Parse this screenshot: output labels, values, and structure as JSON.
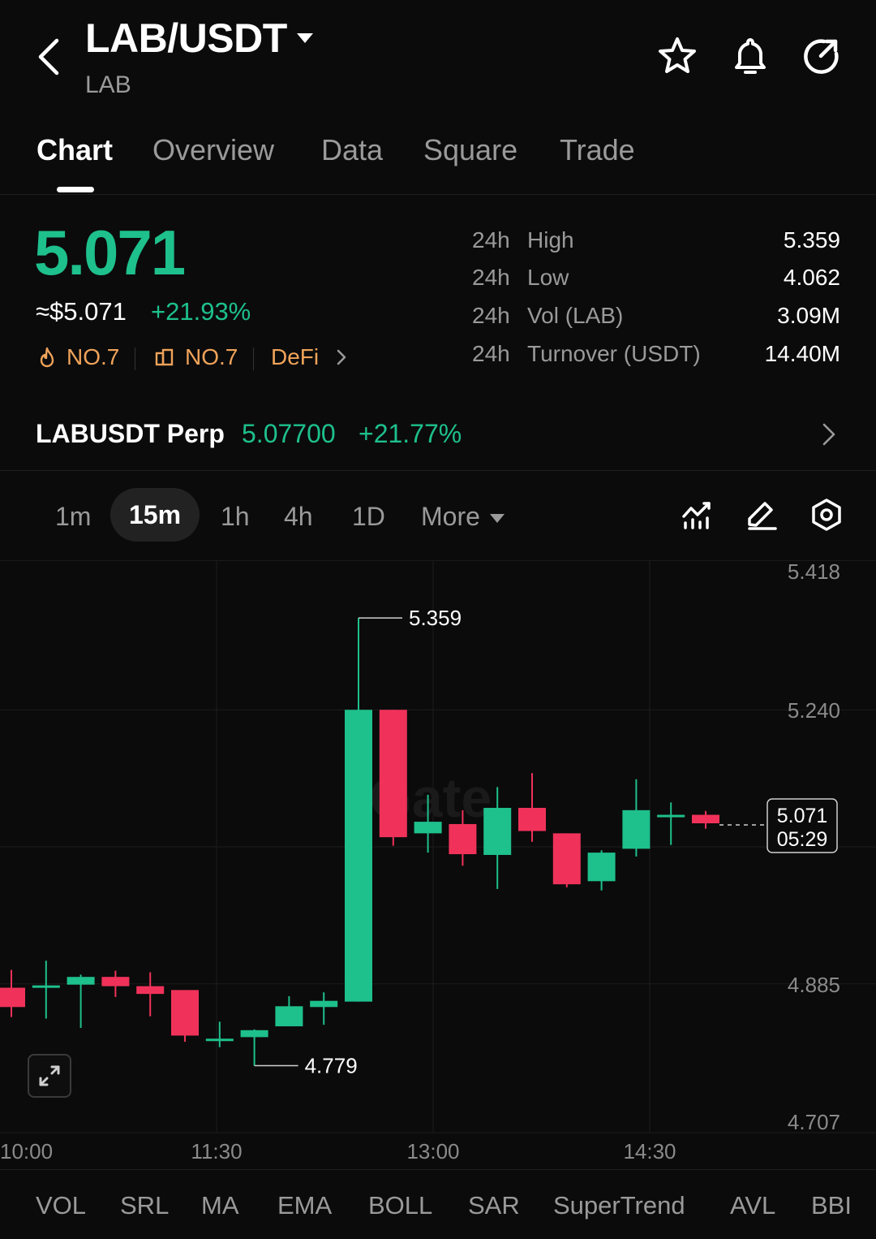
{
  "header": {
    "pair": "LAB/USDT",
    "subtitle": "LAB",
    "icons": [
      "back-arrow-icon",
      "star-icon",
      "bell-icon",
      "share-icon"
    ]
  },
  "tabs": [
    {
      "label": "Chart",
      "active": true
    },
    {
      "label": "Overview",
      "active": false
    },
    {
      "label": "Data",
      "active": false
    },
    {
      "label": "Square",
      "active": false
    },
    {
      "label": "Trade",
      "active": false
    }
  ],
  "price": {
    "last": "5.071",
    "usd": "≈$5.071",
    "change": "+21.93%",
    "tags": [
      {
        "icon": "flame-icon",
        "label": "NO.7"
      },
      {
        "icon": "chart-box-icon",
        "label": "NO.7"
      },
      {
        "icon": "",
        "label": "DeFi"
      }
    ]
  },
  "stats": [
    {
      "period": "24h",
      "label": "High",
      "value": "5.359"
    },
    {
      "period": "24h",
      "label": "Low",
      "value": "4.062"
    },
    {
      "period": "24h",
      "label": "Vol (LAB)",
      "value": "3.09M"
    },
    {
      "period": "24h",
      "label": "Turnover (USDT)",
      "value": "14.40M"
    }
  ],
  "perp": {
    "name": "LABUSDT Perp",
    "price": "5.07700",
    "change": "+21.77%"
  },
  "timeframes": {
    "items": [
      "1m",
      "15m",
      "1h",
      "4h",
      "1D"
    ],
    "active": "15m",
    "more": "More"
  },
  "chart_data": {
    "type": "candlestick",
    "x_ticks": [
      "10:00",
      "11:30",
      "13:00",
      "14:30"
    ],
    "y_ticks": [
      "5.418",
      "5.240",
      "4.885",
      "4.707"
    ],
    "ylim": [
      4.707,
      5.418
    ],
    "annotations": {
      "high": "5.359",
      "low": "4.779"
    },
    "current_price": "5.071",
    "countdown": "05:29",
    "watermark": "Gate",
    "up_color": "#1ec08c",
    "down_color": "#f0325a",
    "candles": [
      {
        "o": 4.88,
        "h": 4.903,
        "l": 4.842,
        "c": 4.855
      },
      {
        "o": 4.883,
        "h": 4.915,
        "l": 4.84,
        "c": 4.883
      },
      {
        "o": 4.884,
        "h": 4.897,
        "l": 4.828,
        "c": 4.894
      },
      {
        "o": 4.894,
        "h": 4.902,
        "l": 4.868,
        "c": 4.882
      },
      {
        "o": 4.882,
        "h": 4.9,
        "l": 4.843,
        "c": 4.872
      },
      {
        "o": 4.877,
        "h": 4.877,
        "l": 4.81,
        "c": 4.818
      },
      {
        "o": 4.814,
        "h": 4.836,
        "l": 4.803,
        "c": 4.814
      },
      {
        "o": 4.816,
        "h": 4.826,
        "l": 4.779,
        "c": 4.825
      },
      {
        "o": 4.83,
        "h": 4.869,
        "l": 4.83,
        "c": 4.856
      },
      {
        "o": 4.855,
        "h": 4.874,
        "l": 4.832,
        "c": 4.863
      },
      {
        "o": 4.862,
        "h": 5.359,
        "l": 4.862,
        "c": 5.24
      },
      {
        "o": 5.24,
        "h": 5.24,
        "l": 5.064,
        "c": 5.075
      },
      {
        "o": 5.08,
        "h": 5.13,
        "l": 5.055,
        "c": 5.095
      },
      {
        "o": 5.092,
        "h": 5.11,
        "l": 5.038,
        "c": 5.053
      },
      {
        "o": 5.052,
        "h": 5.14,
        "l": 5.008,
        "c": 5.113
      },
      {
        "o": 5.113,
        "h": 5.158,
        "l": 5.069,
        "c": 5.083
      },
      {
        "o": 5.08,
        "h": 5.08,
        "l": 5.01,
        "c": 5.014
      },
      {
        "o": 5.018,
        "h": 5.058,
        "l": 5.006,
        "c": 5.055
      },
      {
        "o": 5.06,
        "h": 5.15,
        "l": 5.05,
        "c": 5.11
      },
      {
        "o": 5.101,
        "h": 5.12,
        "l": 5.065,
        "c": 5.104
      },
      {
        "o": 5.104,
        "h": 5.109,
        "l": 5.086,
        "c": 5.093
      }
    ]
  },
  "indicators": [
    "VOL",
    "SRL",
    "MA",
    "EMA",
    "BOLL",
    "SAR",
    "SuperTrend",
    "AVL",
    "BBI"
  ],
  "colors": {
    "up": "#1ec08c",
    "down": "#f0325a",
    "tag": "#f0a35a",
    "bg": "#0b0b0b"
  }
}
